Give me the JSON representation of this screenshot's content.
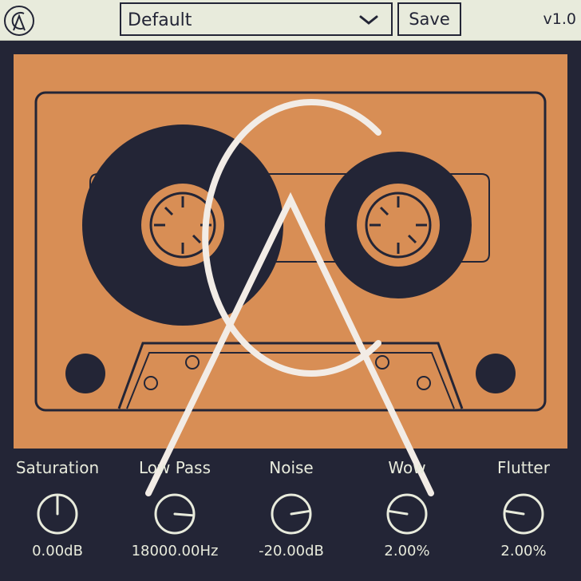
{
  "header": {
    "preset_value": "Default",
    "save_label": "Save",
    "version": "v1.0"
  },
  "controls": [
    {
      "label": "Saturation",
      "value": "0.00dB",
      "knob_level": 0.5
    },
    {
      "label": "Low Pass",
      "value": "18000.00Hz",
      "knob_level": 0.85
    },
    {
      "label": "Noise",
      "value": "-20.00dB",
      "knob_level": 0.8
    },
    {
      "label": "Wow",
      "value": "2.00%",
      "knob_level": 0.2
    },
    {
      "label": "Flutter",
      "value": "2.00%",
      "knob_level": 0.2
    }
  ],
  "colors": {
    "background": "#232536",
    "header": "#e8ebdc",
    "cassette": "#d88e55",
    "text_light": "#e8ebdc",
    "text_dark": "#232536"
  },
  "icons": {
    "logo": "ca-logo-icon",
    "dropdown": "chevron-down-icon"
  }
}
